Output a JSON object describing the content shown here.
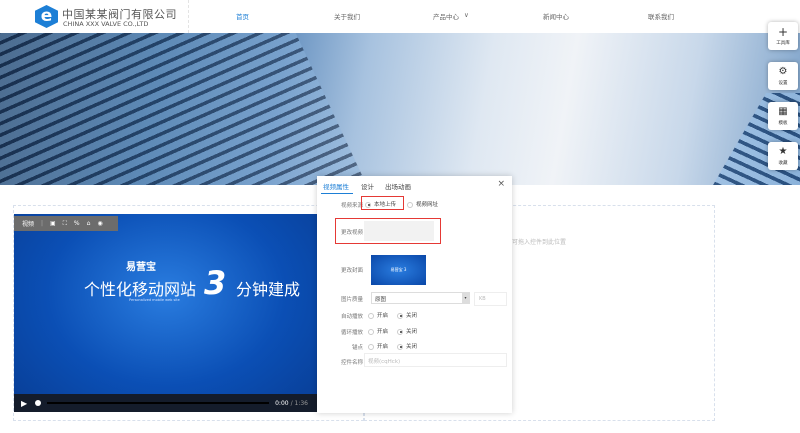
{
  "header": {
    "logo_cn": "中国某某阀门有限公司",
    "logo_en": "CHINA XXX VALVE CO.,LTD",
    "logo_letter": "e",
    "nav": [
      {
        "label": "首页",
        "active": true
      },
      {
        "label": "关于我们"
      },
      {
        "label": "产品中心"
      },
      {
        "label": "新闻中心"
      },
      {
        "label": "联系我们"
      }
    ]
  },
  "colors": {
    "accent": "#1d7fd6",
    "highlight": "#e53935"
  },
  "side": [
    {
      "label": "工具库",
      "icon": "plus-icon"
    },
    {
      "label": "设置",
      "icon": "gears-icon"
    },
    {
      "label": "模板",
      "icon": "template-icon"
    },
    {
      "label": "收藏",
      "icon": "star-icon"
    }
  ],
  "dropzone": {
    "text": "可拖入控件到此位置"
  },
  "video": {
    "toolbar_label": "视频",
    "brand": "易营宝",
    "title_left": "个性化移动网站",
    "three": "3",
    "title_right": "分钟建成",
    "subtitle": "Personalized mobile web site",
    "time_current": "0:00",
    "time_total": "/ 1:36"
  },
  "panel": {
    "tabs": [
      "视频属性",
      "设计",
      "出场动画"
    ],
    "source_label": "视频来源",
    "source_local": "本地上传",
    "source_url": "视频网址",
    "change_video_label": "更改视频",
    "change_cover_label": "更改封面",
    "quality_label": "图片质量",
    "quality_value": "原图",
    "kb_placeholder": "KB",
    "autoplay_label": "自动播放",
    "loop_label": "循环播放",
    "controls_label": "锚点",
    "on": "开启",
    "off": "关闭",
    "name_label": "控件名称",
    "name_placeholder": "视频(cqHck)"
  }
}
